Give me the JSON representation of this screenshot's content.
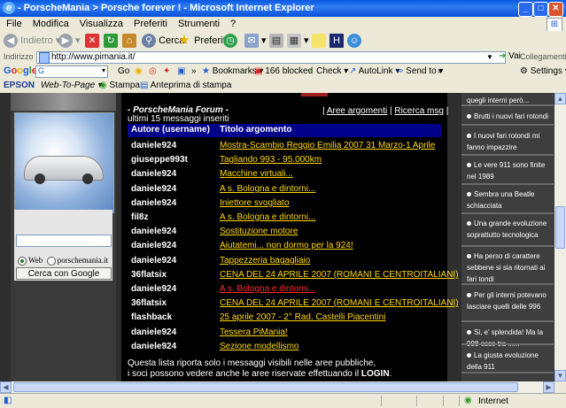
{
  "window": {
    "title": "- PorscheMania > Porsche forever ! - Microsoft Internet Explorer"
  },
  "menu": [
    "File",
    "Modifica",
    "Visualizza",
    "Preferiti",
    "Strumenti",
    "?"
  ],
  "toolbar": {
    "back_label": "Indietro",
    "search_label": "Cerca",
    "favorites_label": "Preferiti"
  },
  "address": {
    "label": "Indirizzo",
    "url": "http://www.pimania.it/",
    "go_label": "Vai",
    "links_label": "Collegamenti"
  },
  "google_bar": {
    "logo": "Google",
    "go_label": "Go",
    "bookmarks_label": "Bookmarks",
    "blocked_label": "166 blocked",
    "check_label": "Check",
    "autolink_label": "AutoLink",
    "sendto_label": "Send to",
    "settings_label": "Settings"
  },
  "epson_bar": {
    "brand": "EPSON",
    "webtopage_label": "Web-To-Page",
    "print_label": "Stampa",
    "preview_label": "Anteprima di stampa"
  },
  "sidebar_search": {
    "radio_web": "Web",
    "radio_site": "porschemania.it",
    "button_label": "Cerca con Google"
  },
  "forum": {
    "title": "- PorscheMania Forum -",
    "link_areas": "Aree argomenti",
    "link_search": "Ricerca msg",
    "subtitle": "ultimi 15 messaggi inseriti",
    "col_author": "Autore (username)",
    "col_topic": "Titolo argomento",
    "rows": [
      {
        "user": "daniele924",
        "topic": "Mostra-Scambio Reggio Emilia 2007 31 Marzo-1 Aprile"
      },
      {
        "user": "giuseppe993t",
        "topic": "Tagliando 993 - 95.000km"
      },
      {
        "user": "daniele924",
        "topic": "Macchine virtuali..."
      },
      {
        "user": "daniele924",
        "topic": "A s. Bologna e dintorni..."
      },
      {
        "user": "daniele924",
        "topic": "Iniettore svogliato"
      },
      {
        "user": "fil8z",
        "topic": "A s. Bologna e dintorni..."
      },
      {
        "user": "daniele924",
        "topic": "Sostituzione motore"
      },
      {
        "user": "daniele924",
        "topic": "Aiutatemi... non dormo per la 924!"
      },
      {
        "user": "daniele924",
        "topic": "Tappezzeria bagagliaio"
      },
      {
        "user": "36flatsix",
        "topic": "CENA DEL 24 APRILE 2007 (ROMANI E CENTROITALIANI)"
      },
      {
        "user": "daniele924",
        "topic": "A s. Bologna e dintorni..."
      },
      {
        "user": "36flatsix",
        "topic": "CENA DEL 24 APRILE 2007 (ROMANI E CENTROITALIANI)"
      },
      {
        "user": "flashback",
        "topic": "25 aprile 2007 - 2° Rad. Castelli Piacentini"
      },
      {
        "user": "daniele924",
        "topic": "Tessera PiMania!"
      },
      {
        "user": "daniele924",
        "topic": "Sezione modellismo"
      }
    ],
    "footnote_line1": "Questa lista riporta solo i messaggi visibili nelle aree pubbliche,",
    "footnote_line2a": "i soci possono vedere anche le aree riservate effettuando il ",
    "footnote_login": "LOGIN",
    "footnote_line2b": "."
  },
  "right_items": [
    "quegli interni però...",
    "Brutti i nuovi fari rotondi",
    "I nuovi fari rotondi mi fanno impazzire",
    "Le vere 911 sono finite nel 1989",
    "Sembra una Beatle schiacciata",
    "Una grande evoluzione soprattutto tecnologica",
    "Ha perso di carattere sebbene si sia ritornati ai fari tondi",
    "Per gli interni potevano lasciare quelli delle 996",
    "Si, e' splendida! Ma la 998 esce tra ......",
    "La giusta evoluzione della 911"
  ],
  "status": {
    "zone": "Internet"
  },
  "colors": {
    "link_yellow": "#ffd800",
    "link_red": "#ff2a2a",
    "header_blue": "#00008b"
  }
}
